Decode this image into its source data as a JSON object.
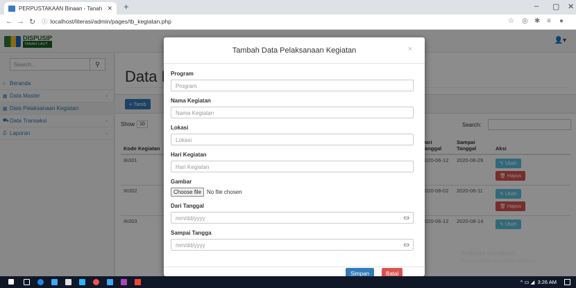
{
  "browser": {
    "tab_title": "PERPUSTAKAAN Binaan - Tanah",
    "url": "localhost/literasi/admin/pages/tb_kegiatan.php"
  },
  "app": {
    "logo_text": "DISPUSIP",
    "logo_sub": "TANAH LAUT",
    "search_placeholder": "Search...",
    "sidebar": [
      {
        "label": "Beranda",
        "icon": "home-icon"
      },
      {
        "label": "Data Master",
        "icon": "table-icon"
      },
      {
        "label": "Data Pelaksanaan Kegiatan",
        "icon": "table-icon"
      },
      {
        "label": "Data Transaksi",
        "icon": "cart-icon"
      },
      {
        "label": "Laporan",
        "icon": "print-icon"
      }
    ],
    "page_title": "Data P",
    "add_button": "+ Tamb",
    "show_label": "Show",
    "show_value": "10",
    "search_label": "Search:",
    "table": {
      "headers": [
        "Kode Kegiatan",
        "Dari Tanggal",
        "Sampai Tanggal",
        "Aksi"
      ],
      "rows": [
        {
          "kode": "IK001",
          "dari": "2020-06-12",
          "sampai": "2020-06-26"
        },
        {
          "kode": "IK002",
          "dari": "2020-06-02",
          "sampai": "2020-06-11"
        },
        {
          "kode": "IK003",
          "dari": "2020-06-12",
          "sampai": "2020-08-14"
        }
      ],
      "ubah_label": "Ubah",
      "hapus_label": "Hapus"
    },
    "watermark": "Activate Windows",
    "watermark_sub": "Go to Settings to activate Windows."
  },
  "modal": {
    "title": "Tambah Data Pelaksanaan Kegiatan",
    "fields": {
      "program": {
        "label": "Program",
        "placeholder": "Program"
      },
      "nama": {
        "label": "Nama Kegiatan",
        "placeholder": "Nama Kegiatan"
      },
      "lokasi": {
        "label": "Lokasi",
        "placeholder": "Lokasi"
      },
      "hari": {
        "label": "Hari Kegiatan",
        "placeholder": "Hari Kegiatan"
      },
      "gambar": {
        "label": "Gambar",
        "button": "Choose file",
        "status": "No file chosen"
      },
      "dari": {
        "label": "Dari Tanggal",
        "placeholder": "mm/dd/yyyy"
      },
      "sampai": {
        "label": "Sampai Tangga",
        "placeholder": "mm/dd/yyyy"
      }
    },
    "save_label": "Simpan",
    "cancel_label": "Batal"
  },
  "taskbar": {
    "time": "3:26 AM"
  }
}
